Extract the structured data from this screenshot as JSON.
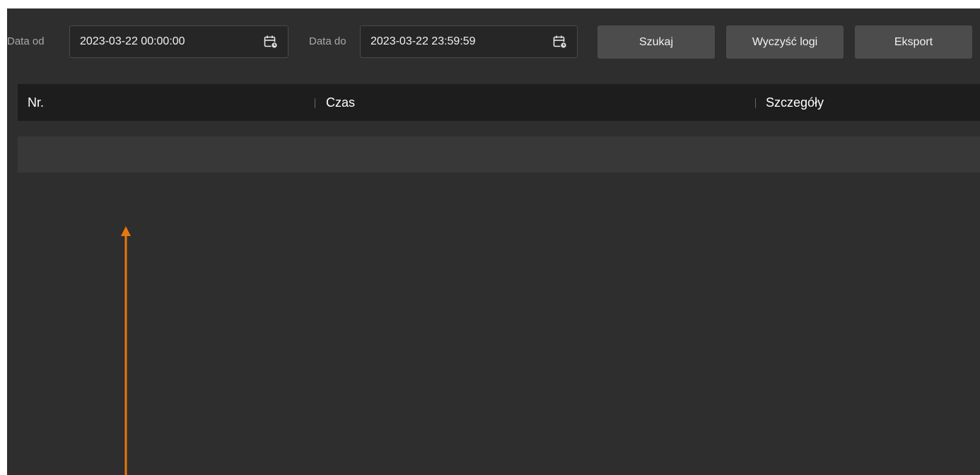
{
  "filters": {
    "from_label": "Data od",
    "from_value": "2023-03-22 00:00:00",
    "to_label": "Data do",
    "to_value": "2023-03-22 23:59:59"
  },
  "buttons": {
    "search": "Szukaj",
    "clear_logs": "Wyczyść logi",
    "export": "Eksport"
  },
  "table": {
    "columns": [
      "Nr.",
      "Czas",
      "Szczegóły"
    ]
  },
  "icons": {
    "calendar": "calendar-clock-icon",
    "annotation": "arrow-up-icon"
  },
  "colors": {
    "background": "#2e2e2e",
    "header": "#1d1d1d",
    "button": "#4c4c4c",
    "annotation_arrow": "#e8780c"
  }
}
